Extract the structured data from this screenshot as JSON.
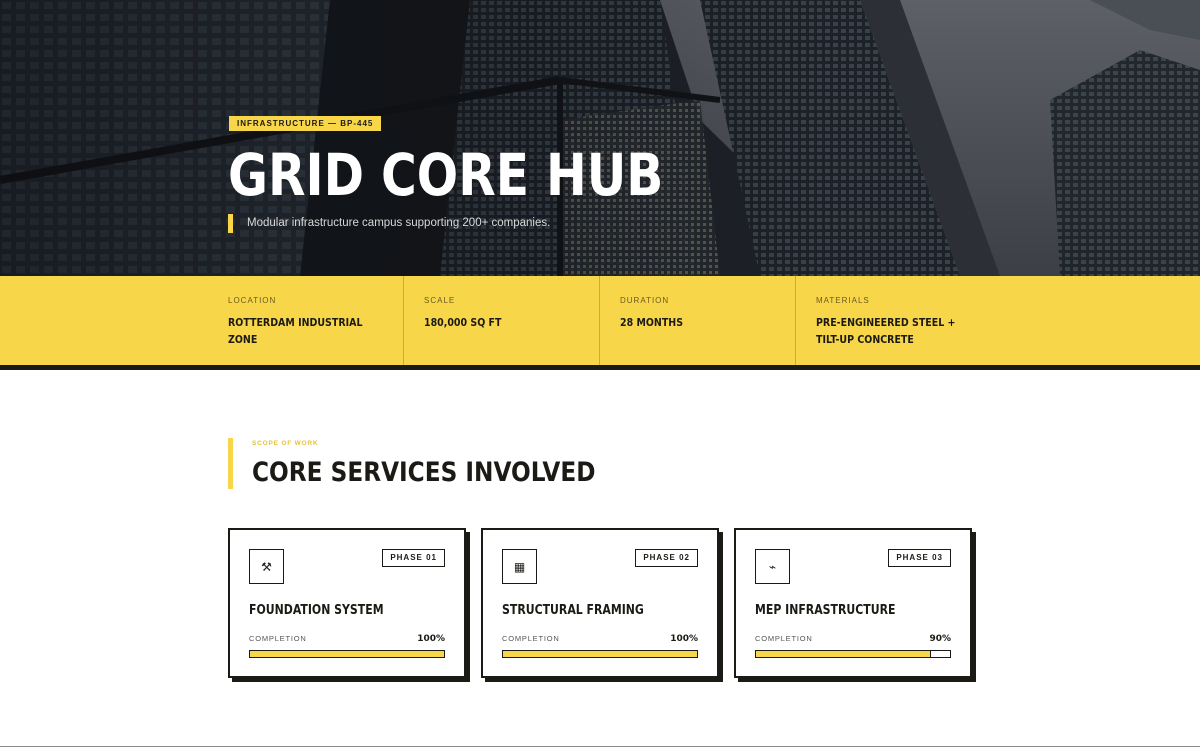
{
  "hero": {
    "badge": "INFRASTRUCTURE — BP-445",
    "title": "GRID CORE HUB",
    "subtitle": "Modular infrastructure campus supporting 200+ companies."
  },
  "stats": [
    {
      "label": "LOCATION",
      "value": "ROTTERDAM INDUSTRIAL ZONE"
    },
    {
      "label": "SCALE",
      "value": "180,000 SQ FT"
    },
    {
      "label": "DURATION",
      "value": "28 MONTHS"
    },
    {
      "label": "MATERIALS",
      "value": "PRE-ENGINEERED STEEL + TILT-UP CONCRETE"
    }
  ],
  "section": {
    "eyebrow": "SCOPE OF WORK",
    "title": "CORE SERVICES INVOLVED"
  },
  "cards": [
    {
      "icon": "hammer-wrench-icon",
      "glyph": "⚒",
      "phase": "PHASE 01",
      "title": "FOUNDATION SYSTEM",
      "completion_label": "COMPLETION",
      "percent_text": "100%",
      "progress": 1.0
    },
    {
      "icon": "building-icon",
      "glyph": "▦",
      "phase": "PHASE 02",
      "title": "STRUCTURAL FRAMING",
      "completion_label": "COMPLETION",
      "percent_text": "100%",
      "progress": 1.0
    },
    {
      "icon": "plug-icon",
      "glyph": "⌁",
      "phase": "PHASE 03",
      "title": "MEP INFRASTRUCTURE",
      "completion_label": "COMPLETION",
      "percent_text": "90%",
      "progress": 0.9
    }
  ],
  "colors": {
    "accent": "#f8d64a",
    "ink": "#1c1a14",
    "hero_dark": "#1c2026"
  }
}
